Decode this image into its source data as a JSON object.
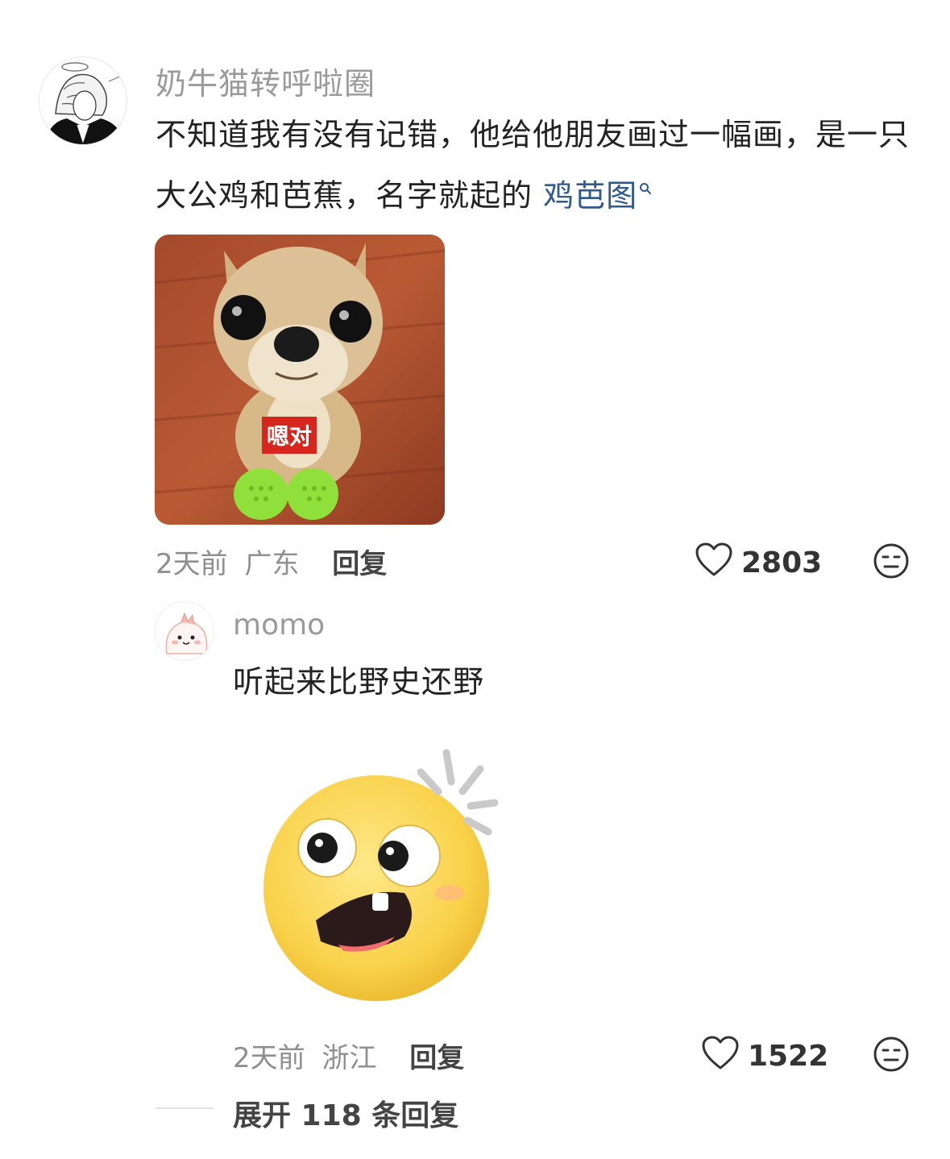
{
  "comment": {
    "username": "奶牛猫转呼啦圈",
    "text_part1": "不知道我有没有记错，他给他朋友画过一幅画，是一只大公鸡和芭蕉，名字就起的 ",
    "topic_link": "鸡芭图",
    "sticker_text": "嗯对",
    "time": "2天前",
    "location": "广东",
    "reply_label": "回复",
    "likes": "2803",
    "icons": {
      "like": "heart-outline-icon",
      "dislike": "meh-face-icon",
      "search": "search-icon"
    }
  },
  "reply": {
    "username": "momo",
    "text": "听起来比野史还野",
    "time": "2天前",
    "location": "浙江",
    "reply_label": "回复",
    "likes": "1522"
  },
  "expand": {
    "label": "展开 118 条回复"
  },
  "colors": {
    "link": "#2f5a8c",
    "muted": "#9a9a9a",
    "text": "#222222",
    "sticker_red": "#d7261d",
    "croc_green": "#8fe03a"
  }
}
